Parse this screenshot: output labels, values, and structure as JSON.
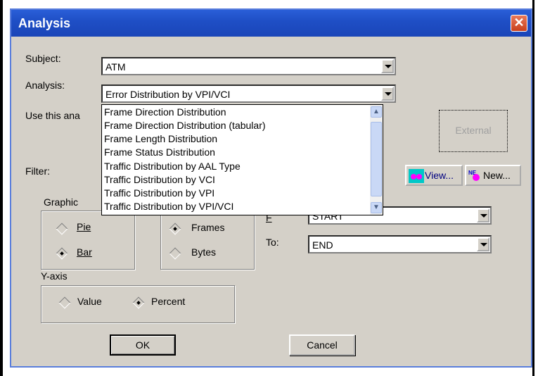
{
  "window": {
    "title": "Analysis",
    "close_label": "✕"
  },
  "subject": {
    "label": "Subject:",
    "value": "ATM"
  },
  "analysis": {
    "label": "Analysis:",
    "value": "Error Distribution by VPI/VCI",
    "list_items": [
      "Frame Direction Distribution",
      "Frame Direction Distribution (tabular)",
      "Frame Length Distribution",
      "Frame Status Distribution",
      "Traffic Distribution by AAL Type",
      "Traffic Distribution by VCI",
      "Traffic Distribution by VPI",
      "Traffic Distribution by VPI/VCI"
    ]
  },
  "use_text": "Use this ana",
  "external_label": "External",
  "filter": {
    "label": "Filter:",
    "view_label": "View...",
    "new_label": "New..."
  },
  "graphic": {
    "label": "Graphic",
    "pie_label": "Pie",
    "bar_label": "Bar",
    "selected": "Bar"
  },
  "units": {
    "frames_label": "Frames",
    "bytes_label": "Bytes",
    "selected": "Frames"
  },
  "range": {
    "from_label": "F",
    "from_value": "START",
    "to_label": "To:",
    "to_value": "END"
  },
  "yaxis": {
    "label": "Y-axis",
    "value_label": "Value",
    "percent_label": "Percent",
    "selected": "Percent"
  },
  "buttons": {
    "ok": "OK",
    "cancel": "Cancel"
  }
}
